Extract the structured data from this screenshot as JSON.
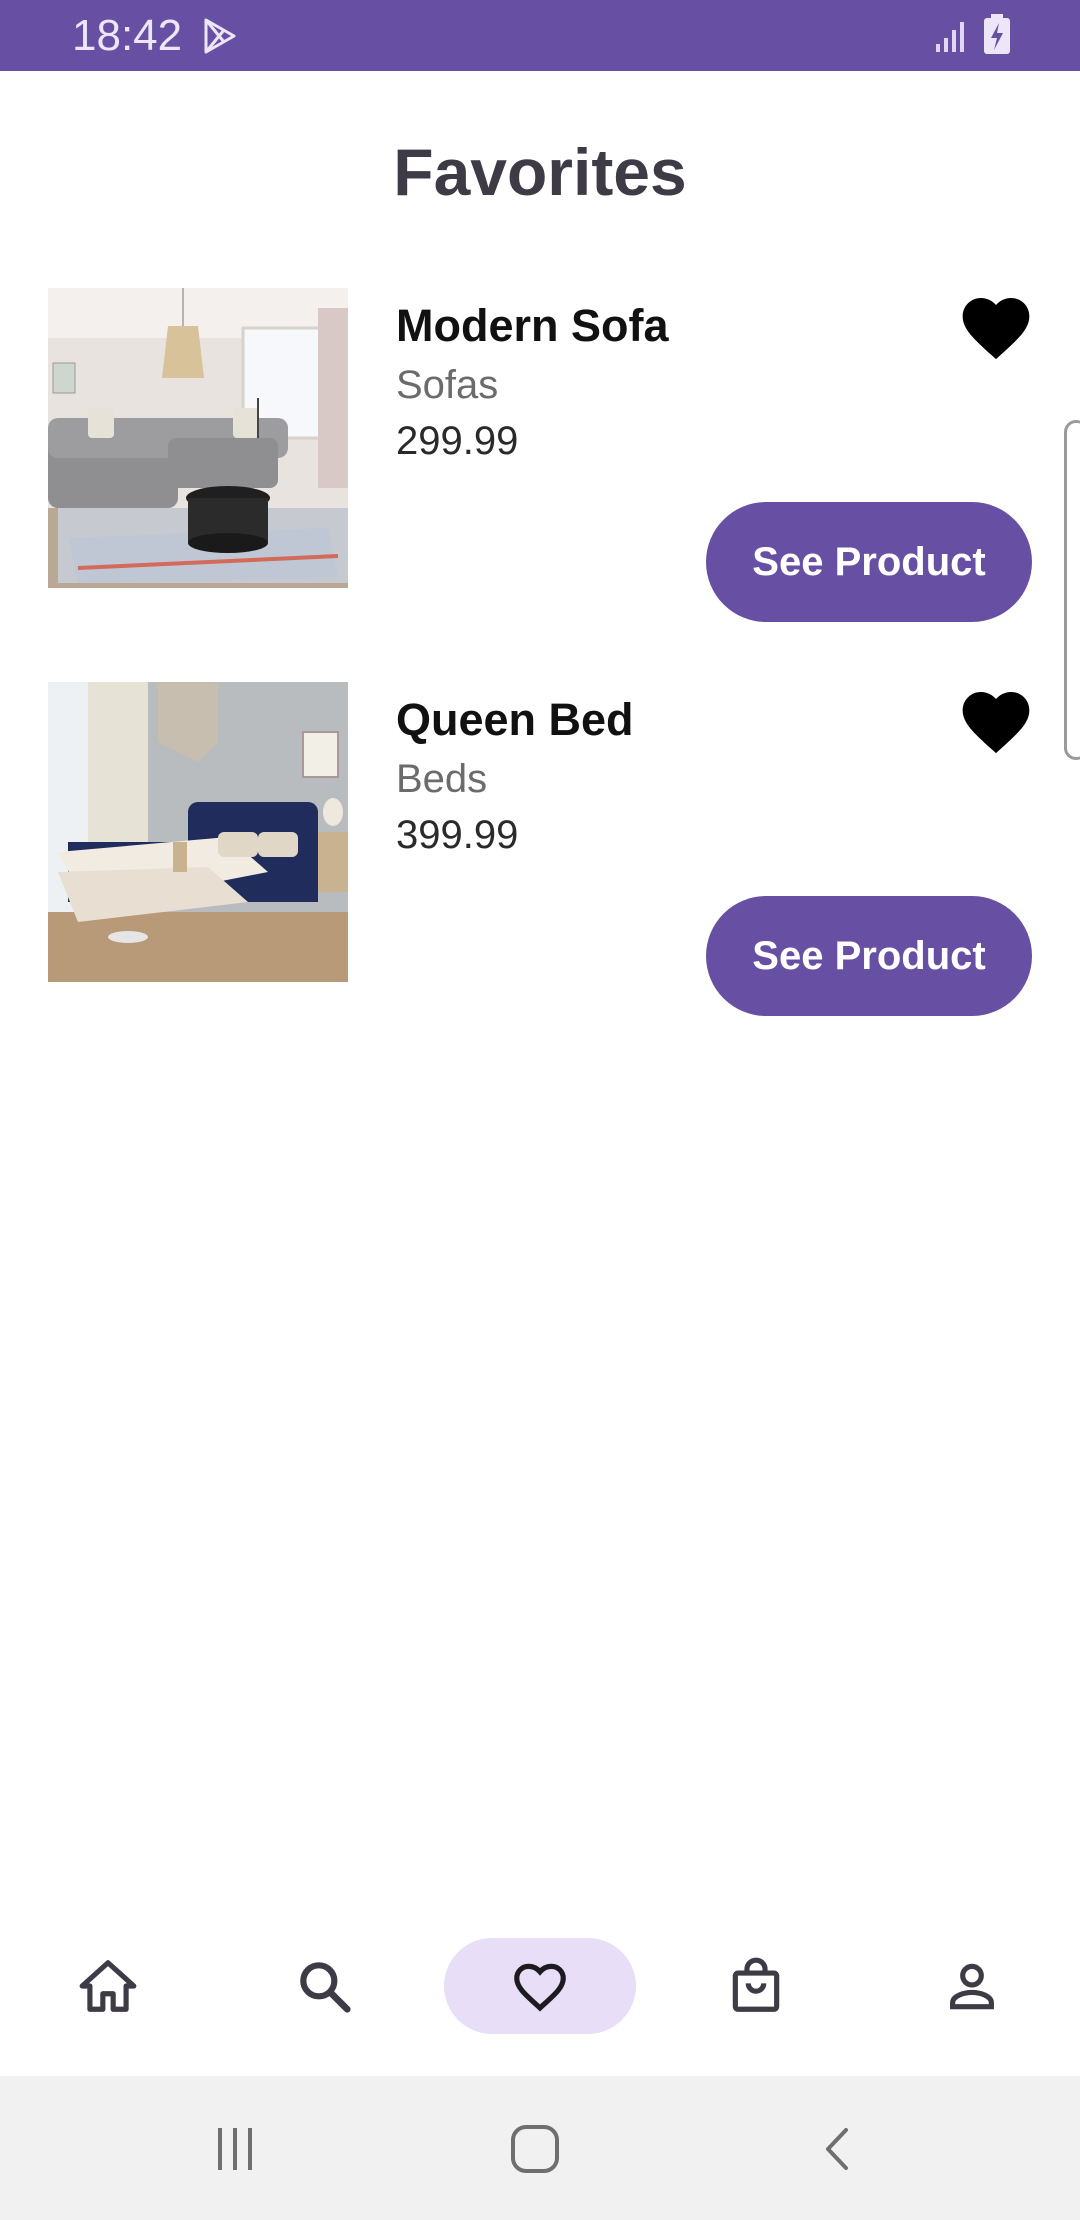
{
  "status_bar": {
    "time": "18:42",
    "icons": [
      "play-store-icon",
      "signal-icon",
      "battery-charging-icon"
    ],
    "color": "#6750A4"
  },
  "page": {
    "title": "Favorites"
  },
  "favorites": [
    {
      "name": "Modern Sofa",
      "category": "Sofas",
      "price": "299.99",
      "button_label": "See Product",
      "image": "living-room-sofa-photo",
      "favorited": true
    },
    {
      "name": "Queen Bed",
      "category": "Beds",
      "price": "399.99",
      "button_label": "See Product",
      "image": "bedroom-bed-photo",
      "favorited": true
    }
  ],
  "bottom_nav": {
    "items": [
      {
        "icon": "home-icon",
        "active": false
      },
      {
        "icon": "search-icon",
        "active": false
      },
      {
        "icon": "heart-icon",
        "active": true
      },
      {
        "icon": "shopping-bag-icon",
        "active": false
      },
      {
        "icon": "person-icon",
        "active": false
      }
    ],
    "active_color": "#E8DEF8"
  },
  "system_nav": [
    "recent-apps-icon",
    "home-circle-icon",
    "back-icon"
  ]
}
